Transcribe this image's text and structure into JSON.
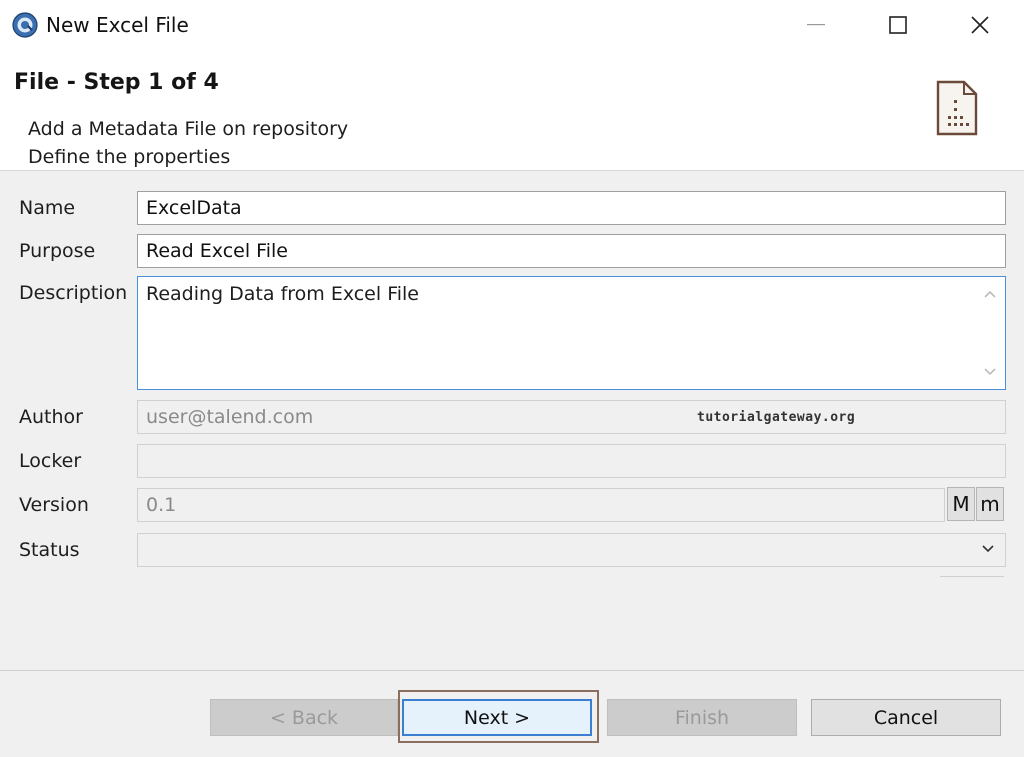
{
  "window": {
    "title": "New Excel File",
    "controls": {
      "minimize": "—",
      "maximize": "☐",
      "close": "✕"
    }
  },
  "header": {
    "step_title": "File - Step 1 of 4",
    "description_line1": "Add a Metadata File on repository",
    "description_line2": "Define the properties",
    "icon": "excel-document-icon"
  },
  "form": {
    "name": {
      "label": "Name",
      "value": "ExcelData"
    },
    "purpose": {
      "label": "Purpose",
      "value": "Read Excel File"
    },
    "description": {
      "label": "Description",
      "value": "Reading Data from Excel File"
    },
    "author": {
      "label": "Author",
      "value": "user@talend.com"
    },
    "locker": {
      "label": "Locker",
      "value": ""
    },
    "version": {
      "label": "Version",
      "value": "0.1",
      "major_label": "M",
      "minor_label": "m"
    },
    "status": {
      "label": "Status",
      "value": ""
    }
  },
  "watermark": "tutorialgateway.org",
  "buttons": {
    "back": "< Back",
    "next": "Next >",
    "finish": "Finish",
    "cancel": "Cancel"
  },
  "colors": {
    "focus_border": "#3c7fd1",
    "highlight_frame": "#8a6e5e"
  }
}
